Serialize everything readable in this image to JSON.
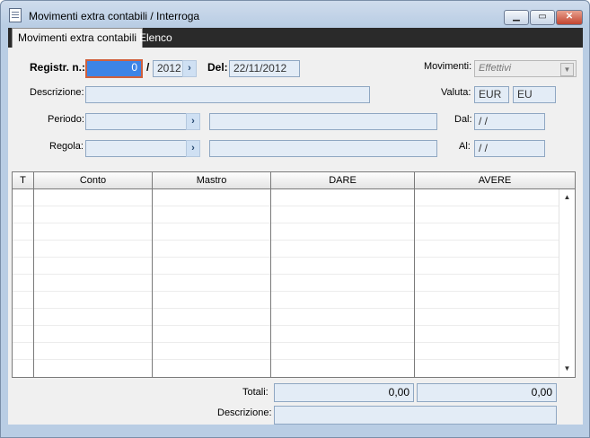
{
  "window": {
    "title": "Movimenti extra contabili / Interroga",
    "minimize_icon": "minimize-icon",
    "maximize_icon": "maximize-icon",
    "close_icon": "close-icon"
  },
  "tabs": [
    {
      "label": "Movimenti extra contabili",
      "active": true
    },
    {
      "label": "Elenco",
      "active": false
    }
  ],
  "form": {
    "registr_label": "Registr. n.:",
    "registr_value": "0",
    "separator": "/",
    "year_value": "2012",
    "del_label": "Del:",
    "del_value": "22/11/2012",
    "movimenti_label": "Movimenti:",
    "movimenti_value": "Effettivi",
    "descrizione_label": "Descrizione:",
    "descrizione_value": "",
    "valuta_label": "Valuta:",
    "valuta_code": "EUR",
    "valuta_symbol": "EU",
    "periodo_label": "Periodo:",
    "periodo_code": "",
    "periodo_desc": "",
    "dal_label": "Dal:",
    "dal_value": " /  /",
    "regola_label": "Regola:",
    "regola_code": "",
    "regola_desc": "",
    "al_label": "Al:",
    "al_value": " /  /"
  },
  "grid": {
    "columns": [
      "T",
      "Conto",
      "Mastro",
      "DARE",
      "AVERE"
    ],
    "rows": 10
  },
  "footer": {
    "totali_label": "Totali:",
    "total_dare": "0,00",
    "total_avere": "0,00",
    "descrizione_label": "Descrizione:",
    "descrizione_value": ""
  },
  "colors": {
    "accent": "#3d84e6",
    "focus_border": "#d0603c",
    "field_bg": "#e3ecf6"
  }
}
